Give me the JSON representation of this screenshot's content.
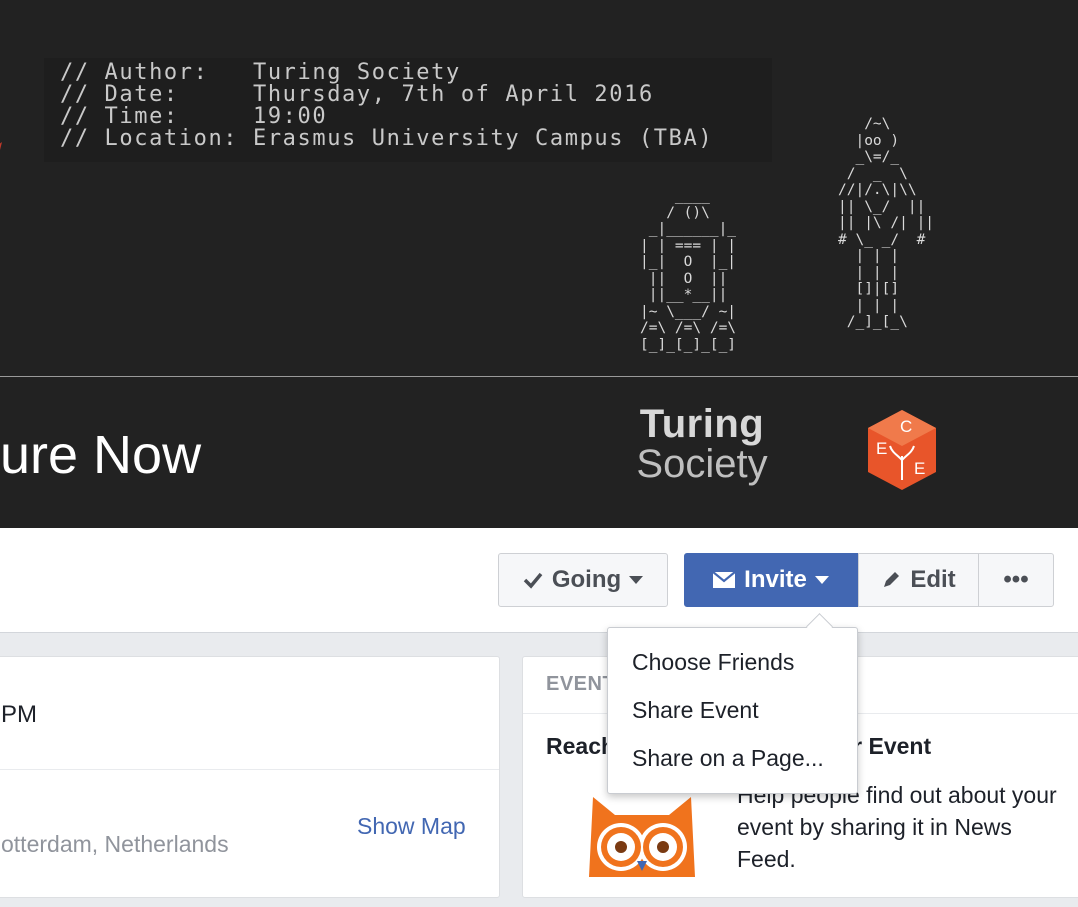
{
  "cover": {
    "code_lines": [
      "// Author:   Turing Society",
      "// Date:     Thursday, 7th of April 2016",
      "// Time:     19:00",
      "// Location: Erasmus University Campus (TBA)"
    ],
    "r2d2_art": "    ____\n   / ()\\\n _|______|_\n| | === | |\n|_|  O  |_|\n ||  O  ||\n ||__*__||\n|~ \\___/ ~|\n/=\\ /=\\ /=\\\n[_]_[_]_[_]",
    "c3po_art": "   /~\\\n  |oo )\n  _\\=/_\n /  _  \\\n//|/.\\|\\\\\n|| \\_/  ||\n|| |\\ /| ||\n# \\_ _/  #\n  | | |\n  | | |\n  []|[]\n  | | |\n /_]_[_\\",
    "title_visible": "ure Now",
    "logo_turing_line1": "Turing",
    "logo_turing_line2": "Society",
    "logo_cee_letters": [
      "C",
      "E",
      "E"
    ]
  },
  "actions": {
    "going_label": "Going",
    "invite_label": "Invite",
    "edit_label": "Edit",
    "more_label": "•••"
  },
  "invite_menu": {
    "items": [
      "Choose Friends",
      "Share Event",
      "Share on a Page..."
    ]
  },
  "details": {
    "time_fragment": "PM",
    "location_fragment": "otterdam, Netherlands",
    "show_map_label": "Show Map"
  },
  "promo": {
    "header_fragment": "EVENT",
    "heading_left": "Reach",
    "heading_right": "Your Event",
    "body": "Help people find out about your event by sharing it in News Feed."
  },
  "colors": {
    "primary": "#4267b2",
    "cover_bg": "#222222",
    "cee_orange": "#e8552a"
  }
}
